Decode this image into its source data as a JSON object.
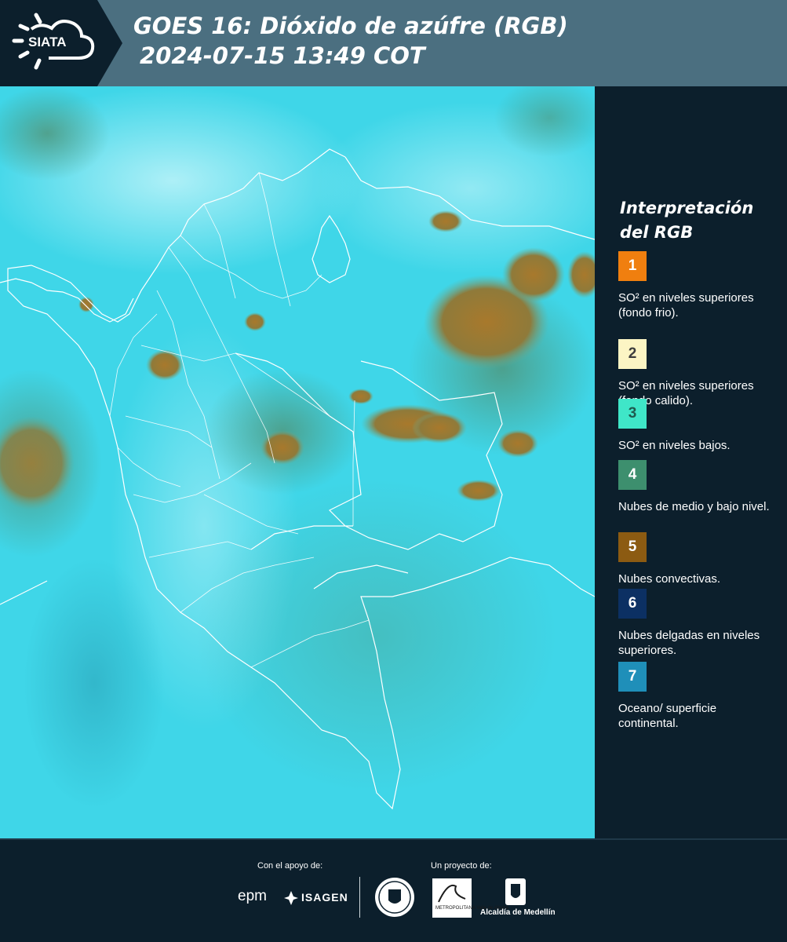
{
  "header": {
    "logo_text": "SIATA",
    "title_line1": "GOES 16: Dióxido de azúfre (RGB)",
    "title_line2": "2024-07-15 13:49 COT",
    "background_color": "#4b6f80",
    "logo_background_color": "#0c1f2c"
  },
  "map": {
    "background_color": "#3fd6e8",
    "cloud_color_convective": "#a6782a",
    "cloud_color_mid": "#5d9a7c",
    "border_color": "#ffffff"
  },
  "legend": {
    "title": "Interpretación del RGB",
    "items": [
      {
        "number": "1",
        "label": "SO² en niveles superiores (fondo frio).",
        "color": "#f07f0f",
        "text_color": "#ffffff"
      },
      {
        "number": "2",
        "label": "SO² en niveles superiores (fondo calido).",
        "color": "#fcf5c4",
        "text_color": "#3d3d3d"
      },
      {
        "number": "3",
        "label": "SO² en niveles bajos.",
        "color": "#3fe6c8",
        "text_color": "#1f5a4e"
      },
      {
        "number": "4",
        "label": "Nubes de medio y bajo nivel.",
        "color": "#3d8f6e",
        "text_color": "#ffffff"
      },
      {
        "number": "5",
        "label": "Nubes convectivas.",
        "color": "#8c5b12",
        "text_color": "#ffffff"
      },
      {
        "number": "6",
        "label": "Nubes delgadas en niveles superiores.",
        "color": "#0c3063",
        "text_color": "#ffffff"
      },
      {
        "number": "7",
        "label": "Oceano/ superficie continental.",
        "color": "#1f8fb9",
        "text_color": "#ffffff"
      }
    ]
  },
  "footer": {
    "support_label": "Con el apoyo de:",
    "project_label": "Un proyecto de:",
    "sponsor_epm": "epm",
    "sponsor_isagen": "ISAGEN",
    "partner_area_sub": "METROPOLITANA Valle de Aburrá",
    "partner_alcaldia": "Alcaldía de Medellín"
  }
}
